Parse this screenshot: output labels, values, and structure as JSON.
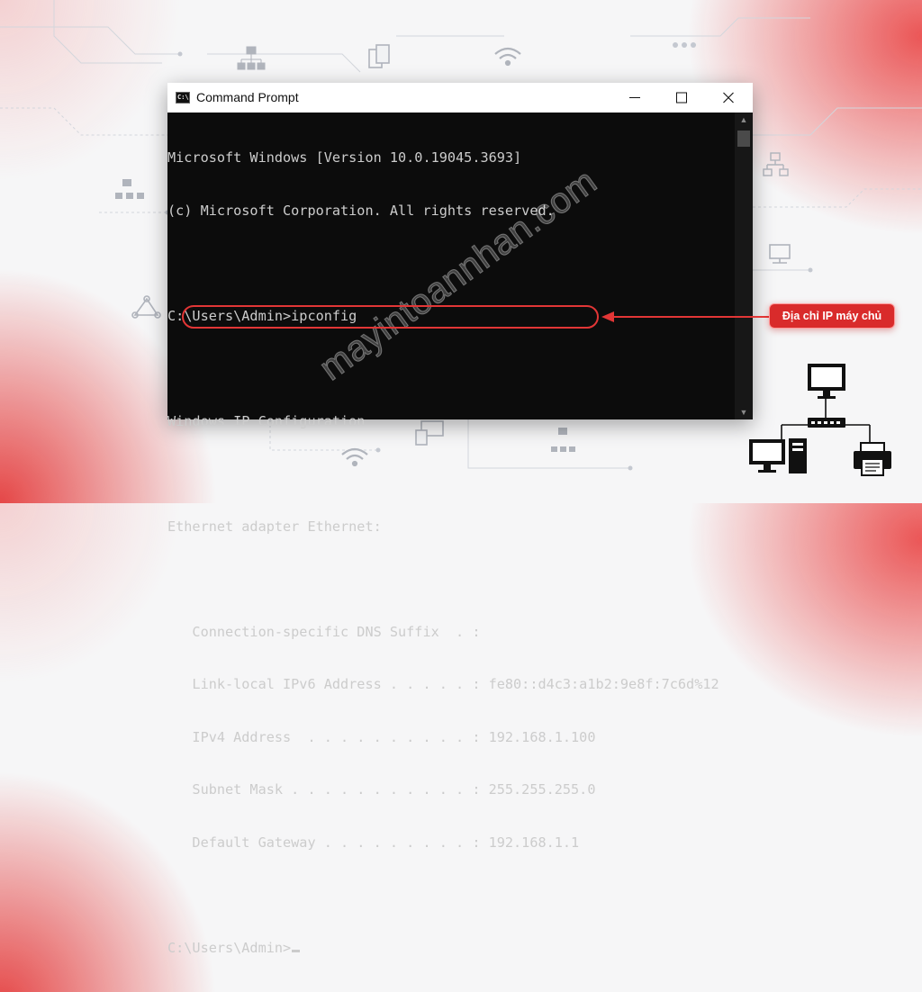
{
  "window": {
    "title": "Command Prompt",
    "icon": "cmd-icon",
    "icon_text": "C:\\"
  },
  "terminal": {
    "lines": [
      "Microsoft Windows [Version 10.0.19045.3693]",
      "(c) Microsoft Corporation. All rights reserved.",
      "",
      "C:\\Users\\Admin>ipconfig",
      "",
      "Windows IP Configuration",
      "",
      "Ethernet adapter Ethernet:",
      "",
      "   Connection-specific DNS Suffix  . :",
      "   Link-local IPv6 Address . . . . . : fe80::d4c3:a1b2:9e8f:7c6d%12",
      "   IPv4 Address  . . . . . . . . . . : 192.168.1.100",
      "   Subnet Mask . . . . . . . . . . . : 255.255.255.0",
      "   Default Gateway . . . . . . . . . : 192.168.1.1",
      ""
    ],
    "prompt": "C:\\Users\\Admin>"
  },
  "annotation": {
    "callout_label": "Địa chỉ IP máy chủ",
    "accent_color": "#e23636"
  },
  "watermark": {
    "text": "mayintoannhan.com"
  },
  "background_icons": [
    "sitemap-icon",
    "documents-icon",
    "wifi-icon",
    "wifi-icon",
    "network-hub-icon",
    "computer-lock-icon",
    "network-share-icon",
    "devices-icon",
    "network-share-icon"
  ],
  "network_diagram_icons": [
    "monitor-icon",
    "switch-icon",
    "desktop-computer-icon",
    "printer-icon"
  ]
}
